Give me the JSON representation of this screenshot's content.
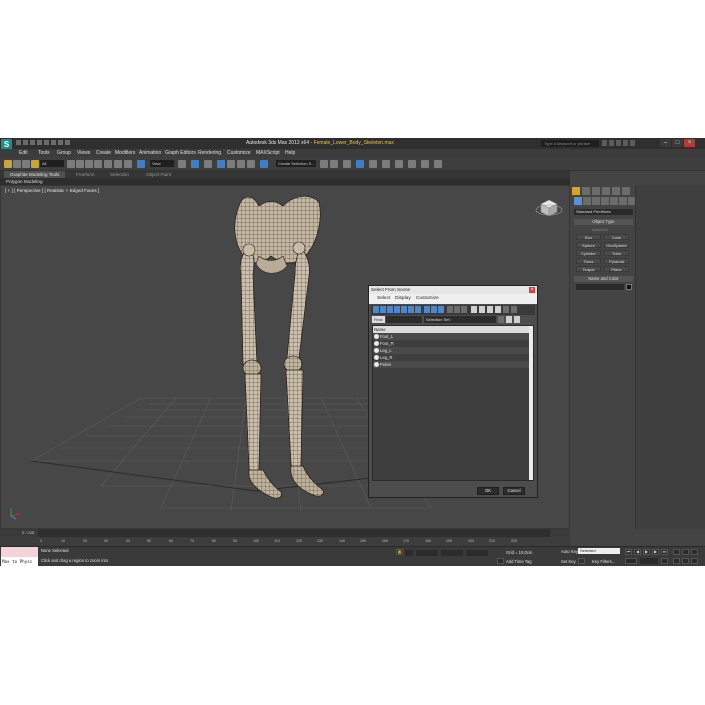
{
  "app": {
    "title_prefix": "Autodesk 3ds Max 2012 x64",
    "file_name": "Female_Lower_Body_Skeleton.max",
    "search_placeholder": "Type a keyword or phrase",
    "logo": "S",
    "accent": "#1c8f8a"
  },
  "menu": [
    "Edit",
    "Tools",
    "Group",
    "Views",
    "Create",
    "Modifiers",
    "Animation",
    "Graph Editors",
    "Rendering",
    "Customize",
    "MAXScript",
    "Help"
  ],
  "toolbar": {
    "filter_value": "All",
    "view_value": "View",
    "selection_set": "Create Selection S..."
  },
  "ribbon": {
    "tabs": [
      "Graphite Modeling Tools",
      "Freeform",
      "Selection",
      "Object Paint"
    ],
    "subpanel": "Polygon Modeling"
  },
  "viewport": {
    "label": "[ + ] [ Perspective ] [ Realistic + Edged Faces ]"
  },
  "command_panel": {
    "dropdown_value": "Standard Primitives",
    "object_type_title": "Object Type",
    "autogrid_label": "AutoGrid",
    "buttons": [
      "Box",
      "Cone",
      "Sphere",
      "GeoSphere",
      "Cylinder",
      "Tube",
      "Torus",
      "Pyramid",
      "Teapot",
      "Plane"
    ],
    "name_color_title": "Name and Color"
  },
  "dialog": {
    "title": "Select From Scene",
    "close": "×",
    "menu": [
      "Select",
      "Display",
      "Customize"
    ],
    "find_label": "Find:",
    "selection_set_label": "Selection Set:",
    "list_header": "Name",
    "items": [
      "Foot_L",
      "Foot_R",
      "Leg_L",
      "Leg_R",
      "Pelvis"
    ],
    "ok_label": "OK",
    "cancel_label": "Cancel"
  },
  "timeline": {
    "frame_label": "0 / 225",
    "ticks": [
      "0",
      "10",
      "20",
      "30",
      "40",
      "50",
      "60",
      "70",
      "80",
      "90",
      "100",
      "110",
      "120",
      "130",
      "140",
      "150",
      "160",
      "170",
      "180",
      "190",
      "200",
      "210",
      "220"
    ]
  },
  "status": {
    "maxscript_text": "Max to Physc",
    "selection": "None Selected",
    "prompt": "Click and drag a region to zoom into",
    "grid": "Grid = 10,0cm",
    "add_time_tag": "Add Time Tag",
    "auto_key": "Auto Key",
    "auto_key_value": "Selected",
    "set_key": "Set Key",
    "key_filters": "Key Filters..."
  }
}
